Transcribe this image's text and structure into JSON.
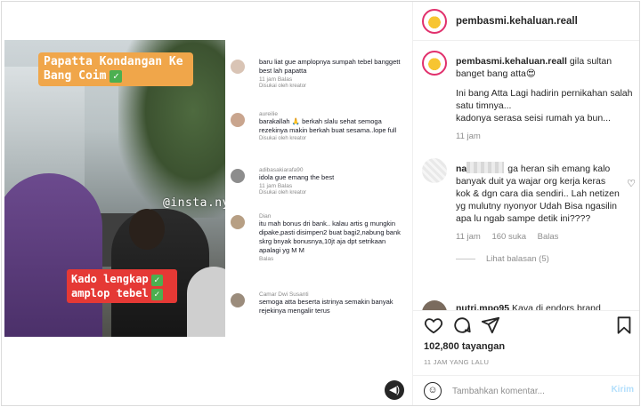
{
  "video": {
    "caption_top": "Papatta Kondangan Ke Bang Coim",
    "caption_top_check": "✓",
    "watermark": "@insta.nyinyir",
    "caption_bottom_1": "Kado lengkap",
    "caption_bottom_2": "amplop tebel",
    "check": "✓",
    "sound_icon": "◀)"
  },
  "tiktok_comments": [
    {
      "name": "",
      "text": "baru liat gue amplopnya sumpah tebel banggett best lah papatta",
      "meta": "11 jam  Balas",
      "red": "Disukai oleh kreator"
    },
    {
      "name": "aureilie",
      "text": "barakallah 🙏 berkah slalu sehat semoga rezekinya makin berkah buat sesama..lope full",
      "meta": "Balas",
      "red": "Disukai oleh kreator"
    },
    {
      "name": "adibasakiarafa90",
      "text": "idola gue emang the best",
      "meta": "11 jam  Balas",
      "red": "Disukai oleh kreator"
    },
    {
      "name": "Dian",
      "text": "itu mah bonus dri bank.. kalau artis g mungkin dipake,pasti disimpen2 buat bagi2,nabung bank skrg bnyak bonusnya,10jt aja dpt setrikaan apalagi yg M M",
      "meta": "Balas",
      "red": ""
    },
    {
      "name": "Camar Dwi Susanti",
      "text": "semoga atta beserta istrinya semakin banyak rejekinya mengalir terus",
      "meta": "",
      "red": ""
    }
  ],
  "post": {
    "username": "pembasmi.kehaluan.reall",
    "caption_main": "gila sultan banget bang atta😍",
    "caption_line2": "Ini bang Atta Lagi hadirin pernikahan salah satu timnya...",
    "caption_line3": "kadonya serasa seisi rumah ya bun...",
    "caption_time": "11 jam"
  },
  "comment": {
    "user_prefix": "na",
    "user_suffix": "ga heran sih emang kalo banyak duit ya wajar org kerja keras kok & dgn cara dia sendiri.. Lah netizen yg mulutny nyonyor Udah Bisa ngasilin apa lu ngab sampe detik ini????",
    "time": "11 jam",
    "likes": "160 suka",
    "reply": "Balas",
    "replies_label": "Lihat balasan (5)"
  },
  "comment2": {
    "user": "nutri.mpo95",
    "text": "Kaya di endors brand"
  },
  "actions": {
    "views": "102,800 tayangan",
    "posted": "11 JAM YANG LALU"
  },
  "add_comment": {
    "placeholder": "Tambahkan komentar...",
    "send": "Kirim"
  },
  "colors": {
    "accent": "#0095f6",
    "send_disabled": "#b2dffc",
    "avatar_ring": "#e1306c",
    "caption_orange": "#f0a64a",
    "caption_red": "#e53935"
  }
}
